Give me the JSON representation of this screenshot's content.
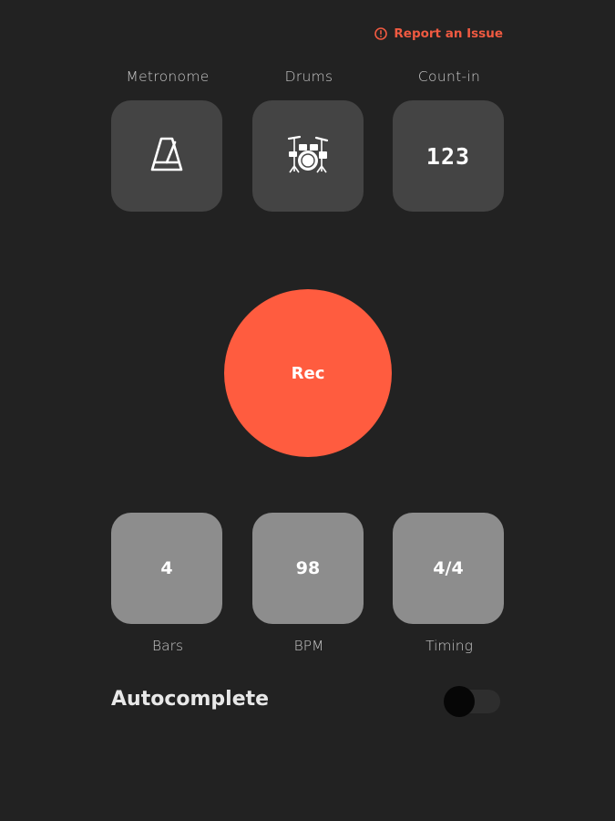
{
  "report": {
    "label": "Report an Issue"
  },
  "colors": {
    "accent": "#ff5c3f",
    "report": "#f05a41",
    "background": "#222222",
    "tile_dark": "#444444",
    "tile_light": "#8d8d8d"
  },
  "top_tiles": [
    {
      "label": "Metronome",
      "icon": "metronome-icon"
    },
    {
      "label": "Drums",
      "icon": "drum-kit-icon"
    },
    {
      "label": "Count-in",
      "icon_text": "123"
    }
  ],
  "record": {
    "label": "Rec"
  },
  "settings": [
    {
      "value": "4",
      "label": "Bars"
    },
    {
      "value": "98",
      "label": "BPM"
    },
    {
      "value": "4/4",
      "label": "Timing"
    }
  ],
  "autocomplete": {
    "label": "Autocomplete",
    "enabled": false
  }
}
